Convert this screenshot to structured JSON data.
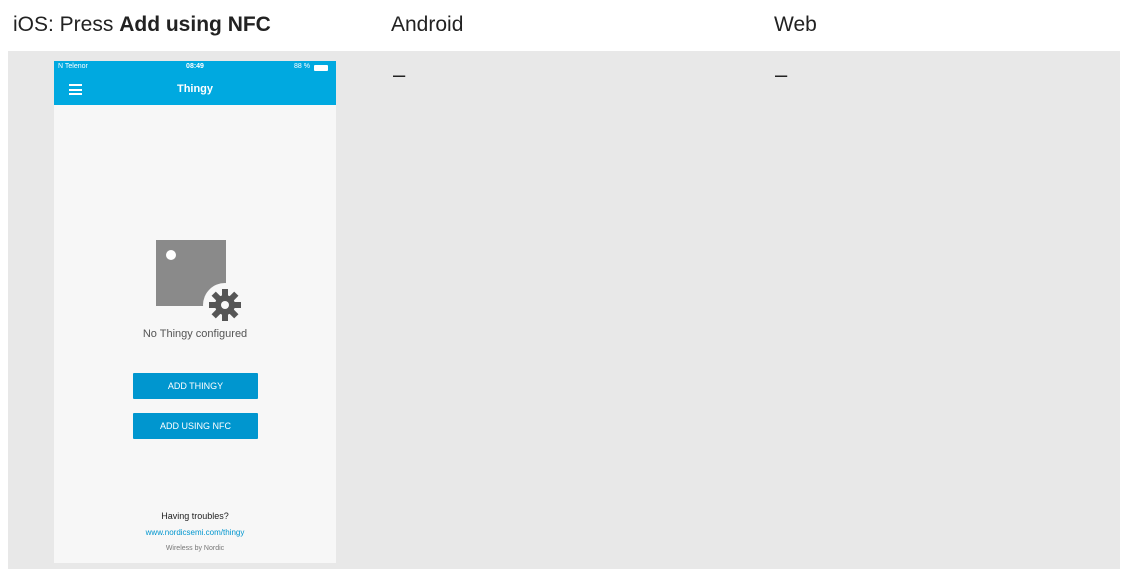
{
  "columns": {
    "ios_prefix": "iOS: Press ",
    "ios_bold": "Add using NFC",
    "android": "Android",
    "web": "Web"
  },
  "cells": {
    "android_value": "–",
    "web_value": "–"
  },
  "phone": {
    "status": {
      "carrier": "N Telenor",
      "time": "08:49",
      "battery": "88 %"
    },
    "title": "Thingy",
    "empty_text": "No Thingy configured",
    "add_thingy": "ADD THINGY",
    "add_nfc": "ADD USING NFC",
    "help_title": "Having troubles?",
    "help_link": "www.nordicsemi.com/thingy",
    "footer": "Wireless by Nordic",
    "accent": "#00a9e0"
  }
}
